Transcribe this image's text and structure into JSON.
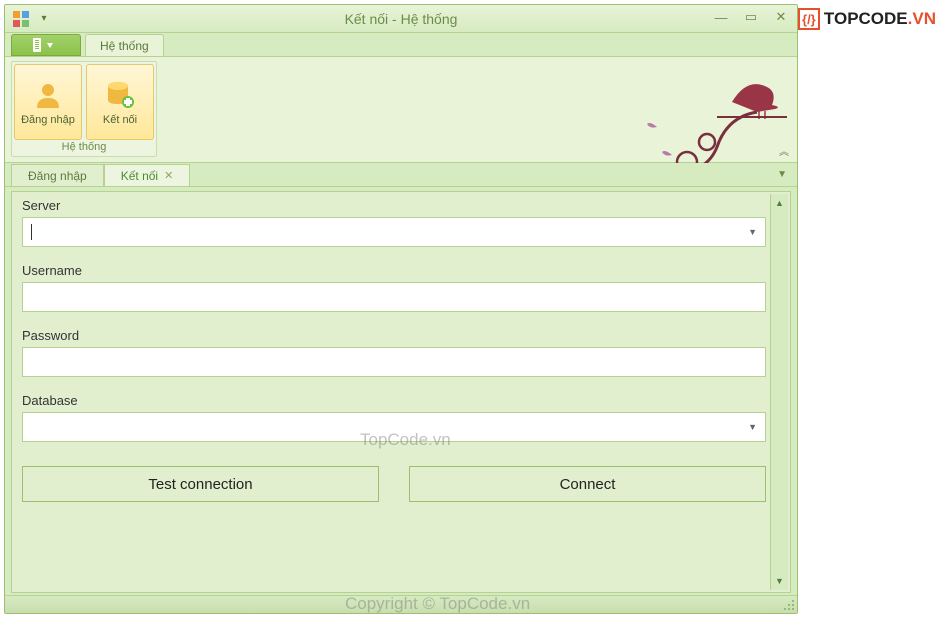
{
  "window": {
    "title": "Kết nối - Hệ thống"
  },
  "ribbon": {
    "tab": "Hệ thống",
    "group_label": "Hệ thống",
    "buttons": {
      "login": "Đăng nhập",
      "connect": "Kết nối"
    }
  },
  "doc_tabs": {
    "login": "Đăng nhập",
    "connect": "Kết nối"
  },
  "form": {
    "server_label": "Server",
    "server_value": "",
    "username_label": "Username",
    "username_value": "",
    "password_label": "Password",
    "password_value": "",
    "database_label": "Database",
    "database_value": ""
  },
  "buttons": {
    "test": "Test connection",
    "connect": "Connect"
  },
  "watermarks": {
    "w1": "TopCode.vn",
    "w2": "Copyright © TopCode.vn"
  },
  "brand": {
    "text": "TOPCODE",
    "suffix": ".VN"
  }
}
